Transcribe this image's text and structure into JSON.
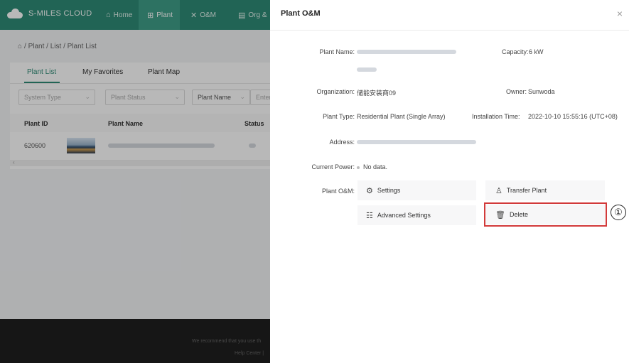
{
  "app": {
    "brand": "S-MILES CLOUD",
    "nav": [
      {
        "label": "Home",
        "icon": "home-icon"
      },
      {
        "label": "Plant",
        "icon": "plant-icon"
      },
      {
        "label": "O&M",
        "icon": "tools-icon"
      },
      {
        "label": "Org &",
        "icon": "org-icon"
      }
    ],
    "breadcrumb": "/ Plant / List / Plant List",
    "tabs": [
      "Plant List",
      "My Favorites",
      "Plant Map"
    ],
    "filters": {
      "system_type": "System Type",
      "plant_status": "Plant Status",
      "plant_name": "Plant Name",
      "search_placeholder": "Enter"
    },
    "table": {
      "headers": [
        "Plant ID",
        "Plant Name",
        "Status"
      ],
      "rows": [
        {
          "plant_id": "620600"
        }
      ]
    },
    "footer": {
      "line1": "We recommend that you use th",
      "line2": "Help Center |"
    }
  },
  "drawer": {
    "title": "Plant O&M",
    "close": "×",
    "fields": {
      "plant_name_label": "Plant Name:",
      "capacity_label": "Capacity:",
      "capacity_value": "6 kW",
      "organization_label": "Organization:",
      "organization_value": "储能安装商09",
      "owner_label": "Owner:",
      "owner_value": "Sunwoda",
      "plant_type_label": "Plant Type:",
      "plant_type_value": "Residential Plant (Single Array)",
      "installation_time_label": "Installation Time:",
      "installation_time_value": "2022-10-10 15:55:16 (UTC+08)",
      "address_label": "Address:",
      "current_power_label": "Current Power:",
      "current_power_value": "No data.",
      "plant_om_label": "Plant O&M:"
    },
    "operations": {
      "settings": "Settings",
      "transfer_plant": "Transfer Plant",
      "advanced_settings": "Advanced Settings",
      "delete": "Delete"
    },
    "step_marker": "①",
    "colors": {
      "brand_green": "#2e8b76",
      "highlight_red": "#d23a3a"
    }
  }
}
